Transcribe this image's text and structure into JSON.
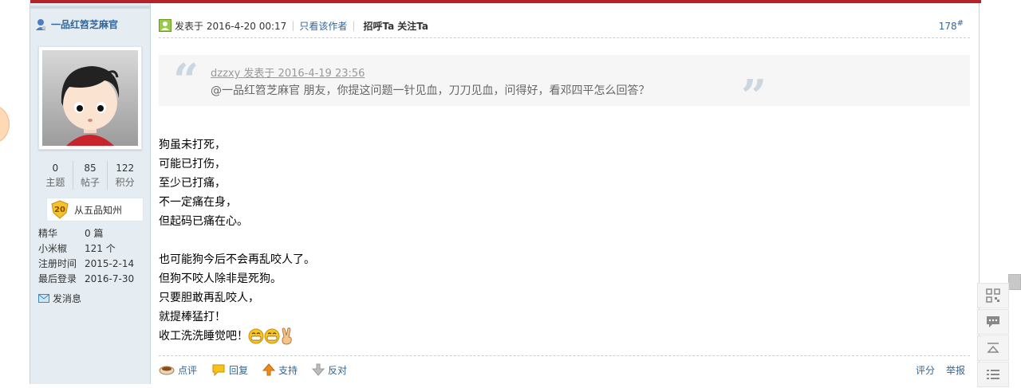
{
  "user": {
    "name": "一品红笤芝麻官",
    "stats": [
      {
        "value": "0",
        "label": "主题"
      },
      {
        "value": "85",
        "label": "帖子"
      },
      {
        "value": "122",
        "label": "积分"
      }
    ],
    "rank": {
      "level": "20",
      "title": "从五品知州"
    },
    "info": [
      {
        "key": "精华",
        "value": "0 篇"
      },
      {
        "key": "小米椒",
        "value": "121 个"
      },
      {
        "key": "注册时间",
        "value": "2015-2-14"
      },
      {
        "key": "最后登录",
        "value": "2016-7-30"
      }
    ],
    "send_message": "发消息"
  },
  "post": {
    "posted_at": "发表于 2016-4-20 00:17",
    "only_author": "只看该作者",
    "greet": "招呼Ta",
    "follow": "关注Ta",
    "floor": "178",
    "floor_mark": "#",
    "quote": {
      "meta": "dzzxy 发表于 2016-4-19 23:56",
      "text": "@一品红笤芝麻官 朋友，你提这问题一针见血，刀刀见血，问得好，看邓四平怎么回答？",
      "open_mark": "“",
      "close_mark": "”"
    },
    "lines_a": [
      "狗虽未打死，",
      "可能已打伤，",
      "至少已打痛，",
      "不一定痛在身，",
      "但起码已痛在心。"
    ],
    "lines_b": [
      "也可能狗今后不会再乱咬人了。",
      "但狗不咬人除非是死狗。",
      "只要胆敢再乱咬人，",
      "就提棒猛打！"
    ],
    "last_line": "收工洗洗睡觉吧！"
  },
  "actions": {
    "comment": "点评",
    "reply": "回复",
    "support": "支持",
    "oppose": "反对",
    "rate": "评分",
    "report": "举报"
  }
}
